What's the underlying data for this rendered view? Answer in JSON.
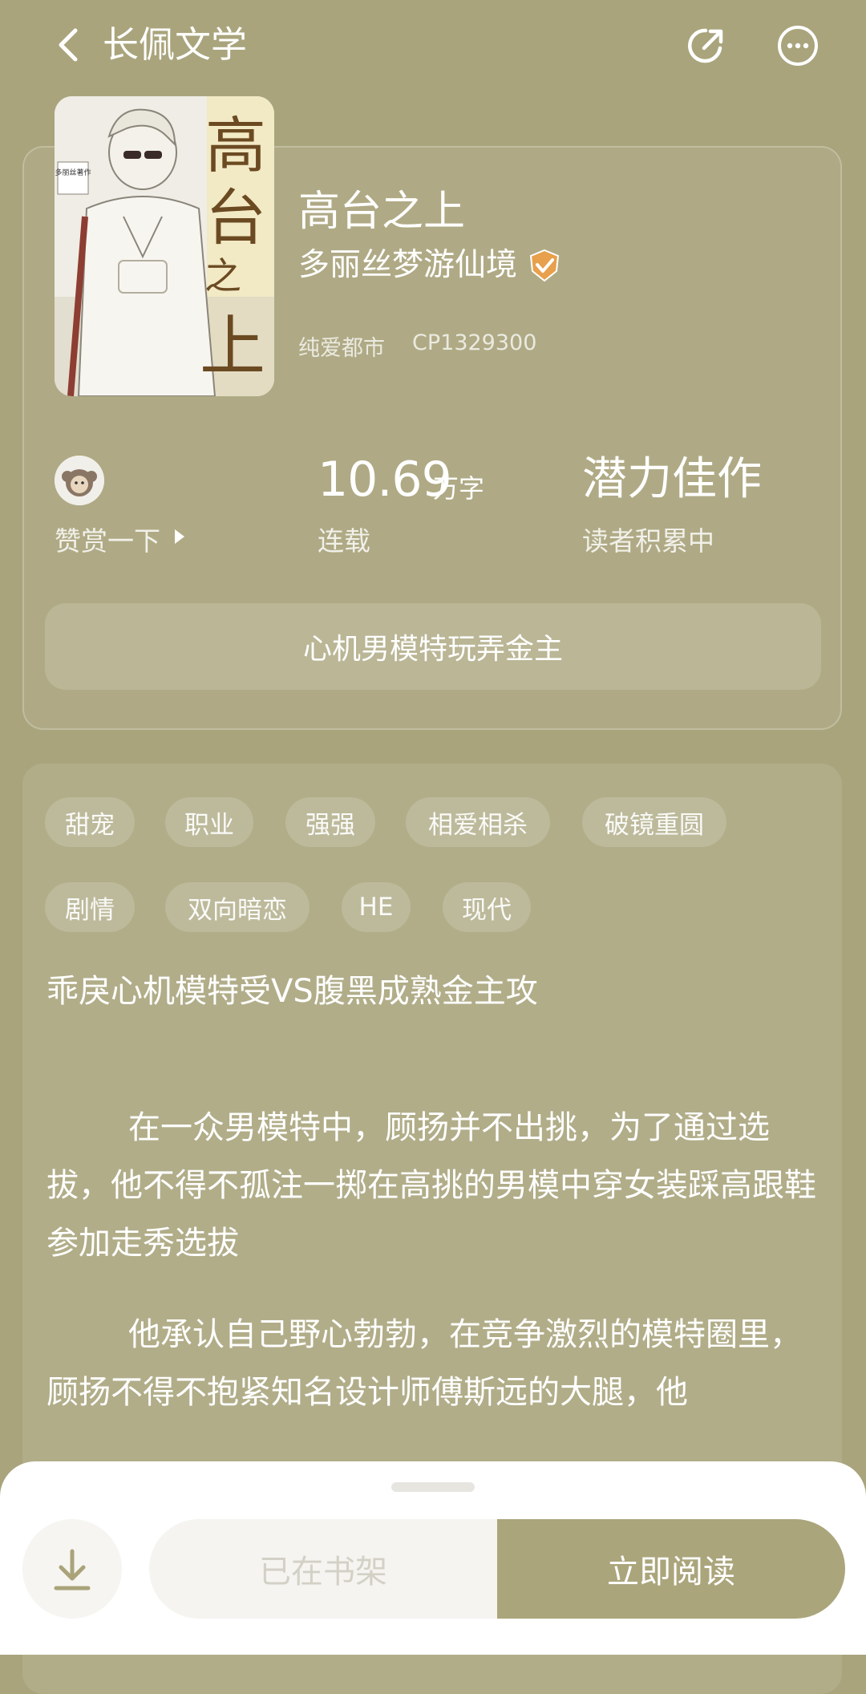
{
  "header": {
    "title": "长佩文学",
    "back_icon": "chevron-left-icon",
    "share_icon": "share-icon",
    "more_icon": "more-icon"
  },
  "book": {
    "cover_title": "高台之上",
    "cover_stamp": "多丽丝著作",
    "title": "高台之上",
    "author": "多丽丝梦游仙境",
    "category": "纯爱都市",
    "copyright_id": "CP1329300"
  },
  "stats": {
    "reward_label": "赞赏一下",
    "word_count": "10.69",
    "word_unit": "万字",
    "status": "连载",
    "rating_title": "潜力佳作",
    "rating_sub": "读者积累中"
  },
  "tagline": "心机男模特玩弄金主",
  "tags": [
    "甜宠",
    "职业",
    "强强",
    "相爱相杀",
    "破镜重圆",
    "剧情",
    "双向暗恋",
    "HE",
    "现代"
  ],
  "description": {
    "headline": "乖戾心机模特受VS腹黑成熟金主攻",
    "para1": "在一众男模特中，顾扬并不出挑，为了通过选拔，他不得不孤注一掷在高挑的男模中穿女装踩高跟鞋参加走秀选拔",
    "para2": "他承认自己野心勃勃，在竞争激烈的模特圈里，顾扬不得不抱紧知名设计师傅斯远的大腿，他"
  },
  "actions": {
    "download_icon": "download-icon",
    "shelf_label": "已在书架",
    "read_label": "立即阅读"
  },
  "colors": {
    "background": "#a9a47c",
    "accent": "#aba57c",
    "verified": "#e8a04c"
  }
}
